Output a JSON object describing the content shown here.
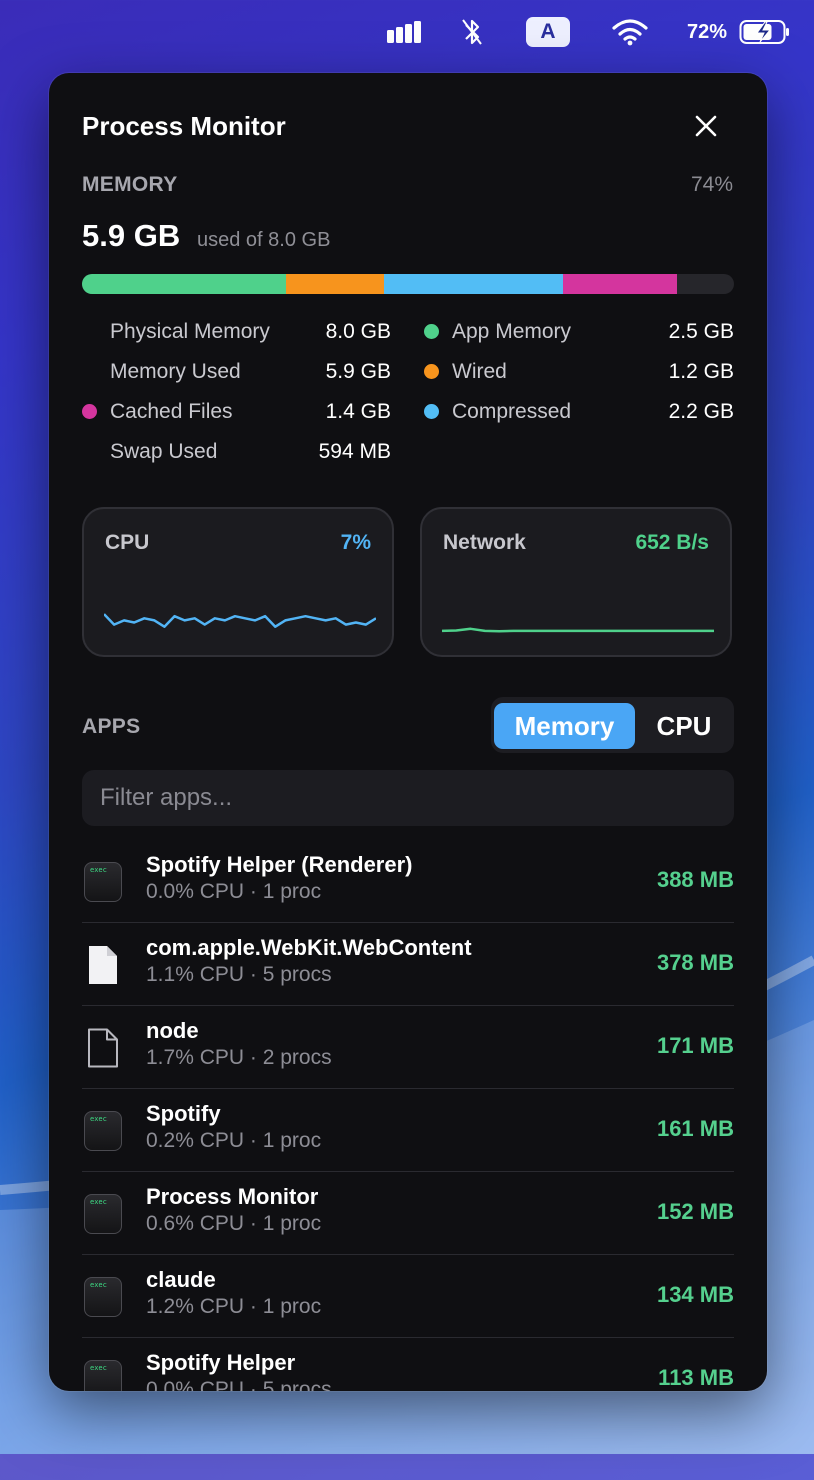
{
  "menubar": {
    "input_source": "A",
    "battery_percent": "72%",
    "icons": [
      "signal-bars-icon",
      "bluetooth-icon",
      "wifi-icon",
      "battery-charging-icon"
    ]
  },
  "panel": {
    "title": "Process Monitor",
    "memory": {
      "label": "MEMORY",
      "percent": "74%",
      "used": "5.9 GB",
      "used_of": "used of 8.0 GB",
      "bar_segments": [
        {
          "name": "App Memory",
          "value_gb": 2.5,
          "color": "#4fd18b"
        },
        {
          "name": "Wired",
          "value_gb": 1.2,
          "color": "#f7941d"
        },
        {
          "name": "Compressed",
          "value_gb": 2.2,
          "color": "#52bdf5"
        },
        {
          "name": "Cached Files",
          "value_gb": 1.4,
          "color": "#d4359e"
        }
      ],
      "total_gb": 8.0,
      "stats_left": [
        {
          "label": "Physical Memory",
          "value": "8.0 GB"
        },
        {
          "label": "Memory Used",
          "value": "5.9 GB"
        },
        {
          "label": "Cached Files",
          "value": "1.4 GB",
          "dot": "#d4359e"
        },
        {
          "label": "Swap Used",
          "value": "594 MB"
        }
      ],
      "stats_right": [
        {
          "label": "App Memory",
          "value": "2.5 GB",
          "dot": "#4fd18b"
        },
        {
          "label": "Wired",
          "value": "1.2 GB",
          "dot": "#f7941d"
        },
        {
          "label": "Compressed",
          "value": "2.2 GB",
          "dot": "#52bdf5"
        }
      ]
    },
    "cpu_card": {
      "label": "CPU",
      "value": "7%",
      "color": "#52b4f5",
      "sparkline": [
        0.45,
        0.2,
        0.3,
        0.25,
        0.35,
        0.3,
        0.15,
        0.4,
        0.3,
        0.35,
        0.2,
        0.35,
        0.3,
        0.4,
        0.35,
        0.3,
        0.4,
        0.15,
        0.3,
        0.35,
        0.4,
        0.35,
        0.3,
        0.35,
        0.2,
        0.25,
        0.2,
        0.35
      ]
    },
    "network_card": {
      "label": "Network",
      "value": "652 B/s",
      "color": "#4fd18b",
      "sparkline": [
        0.05,
        0.06,
        0.1,
        0.05,
        0.04,
        0.05,
        0.05,
        0.05,
        0.05,
        0.05,
        0.05,
        0.05,
        0.05,
        0.05,
        0.05,
        0.05,
        0.05,
        0.05,
        0.05,
        0.05
      ]
    },
    "apps": {
      "label": "APPS",
      "sort_options": [
        "Memory",
        "CPU"
      ],
      "sort_selected": "Memory",
      "filter_placeholder": "Filter apps...",
      "accent": "#55d08e",
      "items": [
        {
          "name": "Spotify Helper (Renderer)",
          "sub": "0.0% CPU · 1 proc",
          "mem": "388 MB",
          "icon": "exec"
        },
        {
          "name": "com.apple.WebKit.WebContent",
          "sub": "1.1% CPU · 5 procs",
          "mem": "378 MB",
          "icon": "document-filled"
        },
        {
          "name": "node",
          "sub": "1.7% CPU · 2 procs",
          "mem": "171 MB",
          "icon": "document-outline"
        },
        {
          "name": "Spotify",
          "sub": "0.2% CPU · 1 proc",
          "mem": "161 MB",
          "icon": "exec"
        },
        {
          "name": "Process Monitor",
          "sub": "0.6% CPU · 1 proc",
          "mem": "152 MB",
          "icon": "exec"
        },
        {
          "name": "claude",
          "sub": "1.2% CPU · 1 proc",
          "mem": "134 MB",
          "icon": "exec"
        },
        {
          "name": "Spotify Helper",
          "sub": "0.0% CPU · 5 procs",
          "mem": "113 MB",
          "icon": "exec"
        }
      ]
    }
  }
}
